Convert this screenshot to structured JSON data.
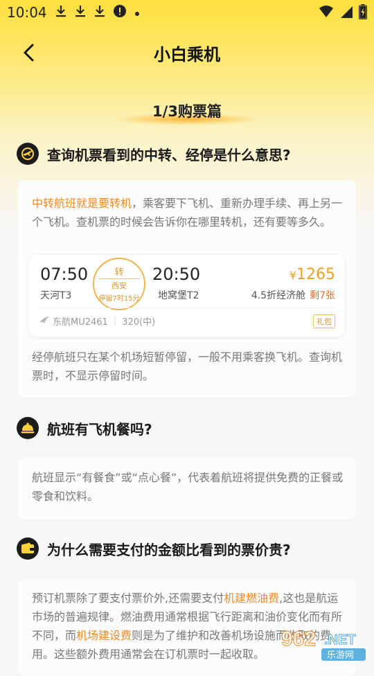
{
  "status_bar": {
    "time": "10:04",
    "icons": [
      "download-icon",
      "download-icon",
      "download-icon",
      "alert-icon",
      "dot-icon"
    ],
    "right_icons": [
      "wifi-icon",
      "signal-icon",
      "battery-icon"
    ]
  },
  "header": {
    "title": "小白乘机",
    "back_icon": "back-arrow-icon"
  },
  "chapter": "1/3购票篇",
  "sections": [
    {
      "question": "查询机票看到的中转、经停是什么意思?",
      "icon": "plane-circle-icon",
      "para1_highlight": "中转航班就是要转机",
      "para1_rest": "，乘客要下飞机、重新办理手续、再上另一个飞机。查机票的时候会告诉你在哪里转机，还有要等多久。",
      "flight": {
        "dep_time": "07:50",
        "dep_airport": "天河T3",
        "transfer_label": "转",
        "transfer_city": "西安",
        "transfer_wait": "停留7时15分",
        "arr_time": "20:50",
        "arr_airport": "地窝堡T2",
        "price_symbol": "¥",
        "price": "1265",
        "cabin": "4.5折经济舱",
        "remaining": "剩7张",
        "airline": "东航MU2461",
        "aircraft": "320(中)",
        "gift": "礼包"
      },
      "para2": "经停航班只在某个机场短暂停留，一般不用乘客换飞机。查询机票时，不显示停留时间。"
    },
    {
      "question": "航班有飞机餐吗?",
      "icon": "meal-cloche-icon",
      "para": "航班显示“有餐食”或“点心餐”，代表着航班将提供免费的正餐或零食和饮料。"
    },
    {
      "question": "为什么需要支付的金额比看到的票价贵?",
      "icon": "wallet-icon",
      "p_a": "预订机票除了要支付票价外,还需要支付",
      "p_hl1": "机建燃油费",
      "p_b": ",这也是航运市场的普遍规律。燃油费用通常根据飞行距离和油价变化而有所不同，而",
      "p_hl2": "机场建设费",
      "p_c": "则是为了维护和改善机场设施而收取的费用。这些额外费用通常会在",
      "p_d": "订机票时一起收取。"
    }
  ],
  "watermark": {
    "brand": "962.NET",
    "sub": "乐游网"
  },
  "colors": {
    "accent": "#f08a24",
    "price": "#f0a020",
    "top_yellow": "#ffdf3c"
  }
}
